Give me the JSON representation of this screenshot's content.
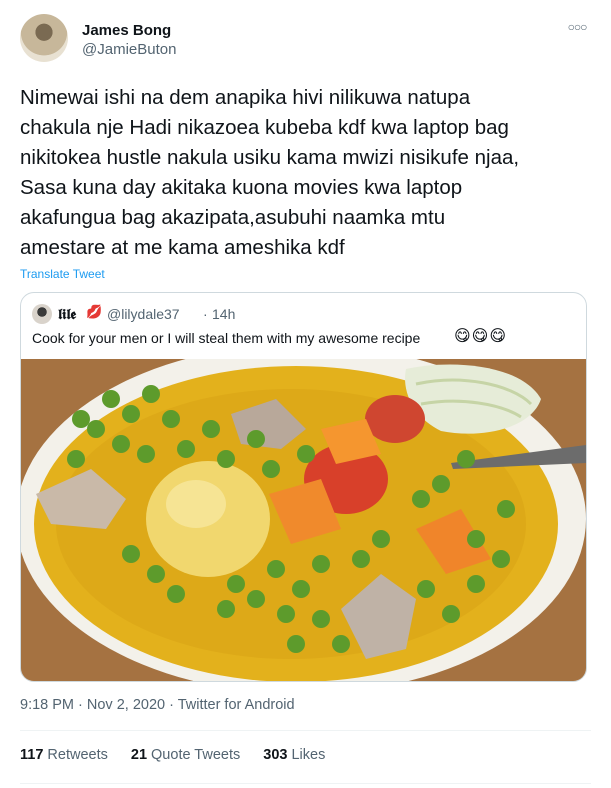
{
  "author": {
    "name": "James Bong",
    "handle": "@JamieButon"
  },
  "more_icon": "more-horizontal-icon",
  "tweet_text": "Nimewai ishi na dem anapika hivi nilikuwa natupa\nchakula nje Hadi nikazoea kubeba kdf kwa laptop bag\nnikitokea hustle nakula usiku kama mwizi nisikufe njaa,\nSasa kuna day akitaka kuona movies kwa laptop\nakafungua bag akazipata,asubuhi naamka mtu\namestare at me kama ameshika kdf",
  "translate_label": "Translate Tweet",
  "quote": {
    "name": "𝖑𝖎𝖑𝖊",
    "lips": "💋",
    "handle": "@lilydale37",
    "dot": "·",
    "time": "14h",
    "text": "Cook for your men or I will steal them with my awesome recipe",
    "emojis": "😋😋😋",
    "image_icon": "food-photo"
  },
  "meta": "9:18 PM · Nov 2, 2020 · Twitter for Android",
  "stats": {
    "retweets_count": "117",
    "retweets_label": "Retweets",
    "quotes_count": "21",
    "quotes_label": "Quote Tweets",
    "likes_count": "303",
    "likes_label": "Likes"
  },
  "colors": {
    "link": "#1d9bf0",
    "secondary": "#536471",
    "primary": "#0f1419",
    "border": "#cfd9de"
  }
}
